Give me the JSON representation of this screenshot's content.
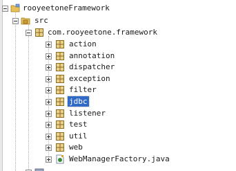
{
  "tree": {
    "project": {
      "label": "rooyeetoneFramework",
      "icon": "project-folder-icon"
    },
    "src": {
      "label": "src",
      "icon": "source-folder-icon"
    },
    "package": {
      "label": "com.rooyeetone.framework",
      "icon": "package-icon"
    },
    "children": [
      {
        "label": "action",
        "icon": "package-icon"
      },
      {
        "label": "annotation",
        "icon": "package-icon"
      },
      {
        "label": "dispatcher",
        "icon": "package-icon"
      },
      {
        "label": "exception",
        "icon": "package-icon"
      },
      {
        "label": "filter",
        "icon": "package-icon"
      },
      {
        "label": "jdbc",
        "icon": "package-icon",
        "selected": true
      },
      {
        "label": "listener",
        "icon": "package-icon"
      },
      {
        "label": "test",
        "icon": "package-icon"
      },
      {
        "label": "util",
        "icon": "package-icon"
      },
      {
        "label": "web",
        "icon": "package-icon"
      },
      {
        "label": "WebManagerFactory.java",
        "icon": "java-file-icon"
      }
    ]
  },
  "colors": {
    "selection": "#3169c6",
    "package": "#c8a24a",
    "folder": "#e8c15a"
  }
}
